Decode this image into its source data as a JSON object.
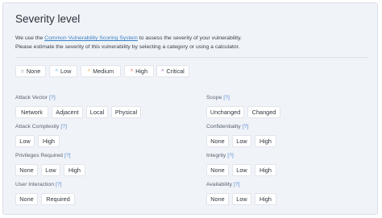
{
  "heading": "Severity level",
  "description": {
    "line1_pre": "We use the ",
    "link": "Common Vulnerability Scoring System",
    "line1_post": " to assess the severity of your vulnerability.",
    "line2": "Please estimate the severity of this vulnerability by selecting a category or using a calculator."
  },
  "severity": [
    {
      "label": "None",
      "icon": "equals-icon",
      "color": "#9aa1ab"
    },
    {
      "label": "Low",
      "icon": "chevron-up-icon",
      "color": "#4ab0d6"
    },
    {
      "label": "Medium",
      "icon": "double-chevron-icon",
      "color": "#e8a33a"
    },
    {
      "label": "High",
      "icon": "triple-chevron-icon",
      "color": "#e0544a"
    },
    {
      "label": "Critical",
      "icon": "triple-chevron-icon",
      "color": "#9b4bc4"
    }
  ],
  "help": "[?]",
  "metrics": {
    "attack_vector": {
      "label": "Attack Vector",
      "options": [
        "Network",
        "Adjacent",
        "Local",
        "Physical"
      ]
    },
    "attack_complexity": {
      "label": "Attack Complexity",
      "options": [
        "Low",
        "High"
      ]
    },
    "privileges_required": {
      "label": "Privileges Required",
      "options": [
        "None",
        "Low",
        "High"
      ]
    },
    "user_interaction": {
      "label": "User Interaction",
      "options": [
        "None",
        "Required"
      ]
    },
    "scope": {
      "label": "Scope",
      "options": [
        "Unchanged",
        "Changed"
      ]
    },
    "confidentiality": {
      "label": "Confidentiality",
      "options": [
        "None",
        "Low",
        "High"
      ]
    },
    "integrity": {
      "label": "Integrity",
      "options": [
        "None",
        "Low",
        "High"
      ]
    },
    "availability": {
      "label": "Availability",
      "options": [
        "None",
        "Low",
        "High"
      ]
    }
  }
}
